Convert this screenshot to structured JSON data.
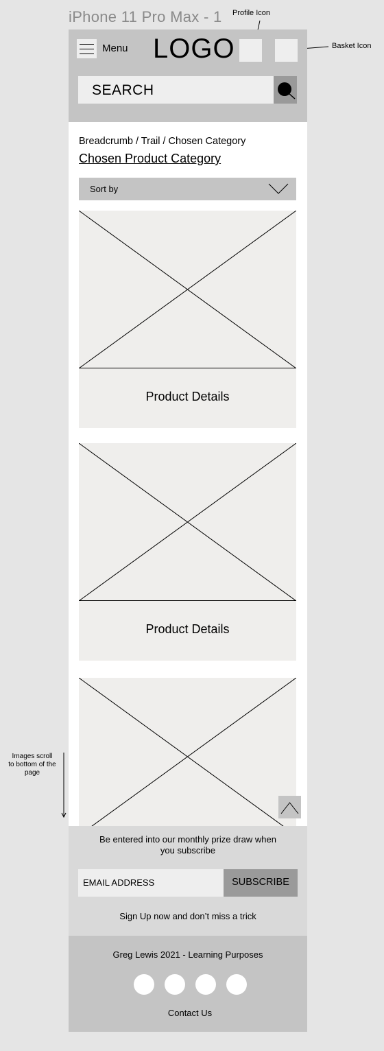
{
  "canvas": {
    "frame_title": "iPhone 11 Pro Max - 1",
    "notes": {
      "profile": "Profile Icon",
      "basket": "Basket Icon",
      "scroll": "Images scroll to bottom of the page"
    }
  },
  "header": {
    "menu_label": "Menu",
    "logo": "LOGO",
    "search_placeholder": "SEARCH"
  },
  "content": {
    "breadcrumb": "Breadcrumb / Trail / Chosen Category",
    "category_title": "Chosen Product Category",
    "sort_label": "Sort by",
    "products": [
      {
        "details": "Product Details"
      },
      {
        "details": "Product Details"
      },
      {
        "details": ""
      }
    ]
  },
  "newsletter": {
    "message": "Be entered into our monthly prize draw when you subscribe",
    "email_placeholder": "EMAIL ADDRESS",
    "subscribe_label": "SUBSCRIBE",
    "tagline": "Sign Up now and don’t miss a trick"
  },
  "footer": {
    "copyright": "Greg Lewis 2021 - Learning Purposes",
    "contact": "Contact Us",
    "social_icons": [
      "social-icon-1",
      "social-icon-2",
      "social-icon-3",
      "social-icon-4"
    ]
  },
  "colors": {
    "header_bg": "#c4c4c4",
    "placeholder_bg": "#efeeec",
    "button_dark": "#9a9a9a",
    "canvas_bg": "#e5e5e5"
  }
}
